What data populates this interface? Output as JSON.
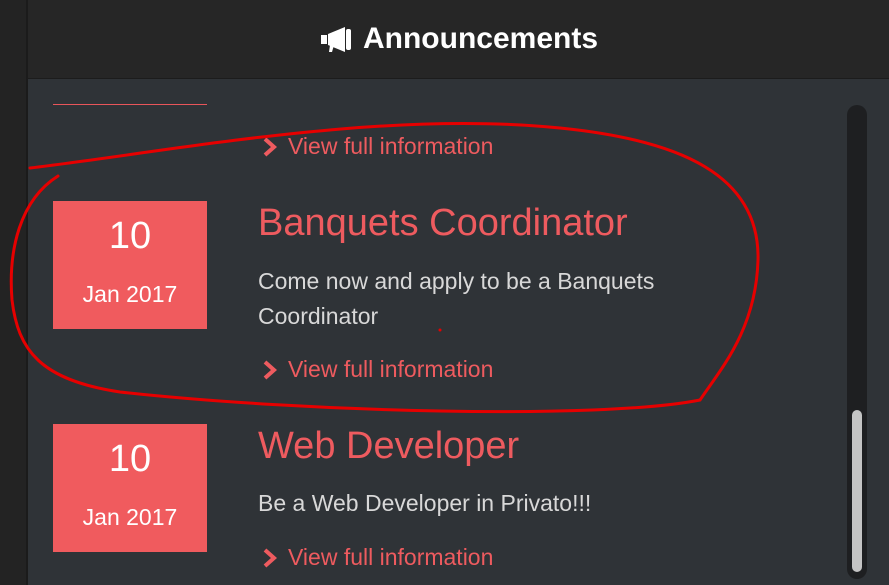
{
  "header": {
    "title": "Announcements",
    "icon": "megaphone-icon"
  },
  "top_link": {
    "label": "View full information",
    "icon": "chevron-right-icon"
  },
  "announcements": [
    {
      "day": "10",
      "month_year": "Jan 2017",
      "title": "Banquets Coordinator",
      "description": "Come now and apply to be a Banquets Coordinator",
      "link_label": "View full information"
    },
    {
      "day": "10",
      "month_year": "Jan 2017",
      "title": "Web Developer",
      "description": "Be a Web Developer in Privato!!!",
      "link_label": "View full information"
    }
  ],
  "colors": {
    "accent": "#ee5b5f",
    "date_box": "#f05b5e",
    "background": "#2f3337",
    "header_bg": "#262626",
    "annotation_stroke": "#e60000"
  }
}
